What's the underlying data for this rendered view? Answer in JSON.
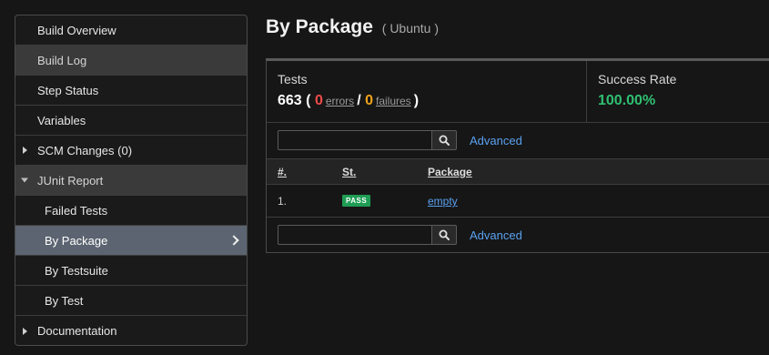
{
  "sidebar": {
    "items": [
      {
        "label": "Build Overview"
      },
      {
        "label": "Build Log"
      },
      {
        "label": "Step Status"
      },
      {
        "label": "Variables"
      },
      {
        "label": "SCM Changes (0)"
      },
      {
        "label": "JUnit Report"
      },
      {
        "label": "Failed Tests"
      },
      {
        "label": "By Package"
      },
      {
        "label": "By Testsuite"
      },
      {
        "label": "By Test"
      },
      {
        "label": "Documentation"
      }
    ]
  },
  "page": {
    "title": "By Package",
    "subtitle": "( Ubuntu )"
  },
  "stats": {
    "tests_label": "Tests",
    "tests_total": "663",
    "open_paren": "(",
    "errors_count": "0",
    "errors_label": "errors",
    "separator": "/",
    "failures_count": "0",
    "failures_label": "failures",
    "close_paren": ")",
    "success_label": "Success Rate",
    "success_value": "100.00%"
  },
  "search": {
    "placeholder": "",
    "advanced_label": "Advanced"
  },
  "table": {
    "headers": {
      "num": "#.",
      "status": "St.",
      "package": "Package"
    },
    "rows": [
      {
        "num": "1.",
        "status": "PASS",
        "package": "empty"
      }
    ]
  },
  "colors": {
    "pass": "#1f9d55",
    "success": "#2fbf71",
    "errors": "#f04a4a",
    "failures": "#f0a21a",
    "link": "#5aa1f0",
    "active_nav": "#5b6470"
  }
}
